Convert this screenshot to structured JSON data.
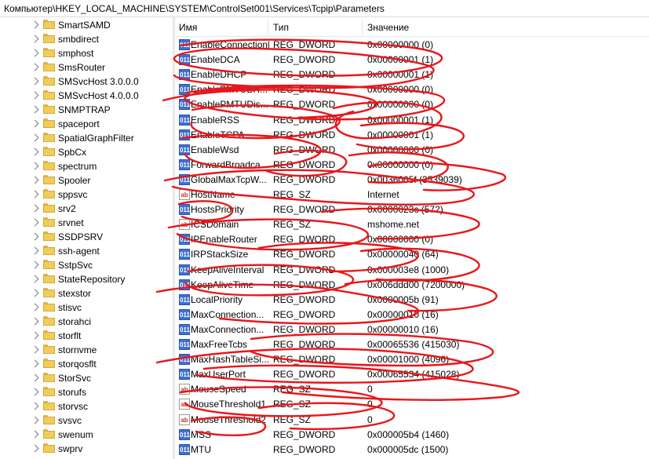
{
  "address": "Компьютер\\HKEY_LOCAL_MACHINE\\SYSTEM\\ControlSet001\\Services\\Tcpip\\Parameters",
  "tree": {
    "items": [
      "SmartSAMD",
      "smbdirect",
      "smphost",
      "SmsRouter",
      "SMSvcHost 3.0.0.0",
      "SMSvcHost 4.0.0.0",
      "SNMPTRAP",
      "spaceport",
      "SpatialGraphFilter",
      "SpbCx",
      "spectrum",
      "Spooler",
      "sppsvc",
      "srv2",
      "srvnet",
      "SSDPSRV",
      "ssh-agent",
      "SstpSvc",
      "StateRepository",
      "stexstor",
      "stisvc",
      "storahci",
      "storflt",
      "stornvme",
      "storqosflt",
      "StorSvc",
      "storufs",
      "storvsc",
      "svsvc",
      "swenum",
      "swprv"
    ]
  },
  "list": {
    "columns": {
      "name": "Имя",
      "type": "Тип",
      "data": "Значение"
    },
    "rows": [
      {
        "icon": "dword-value-icon",
        "name": "EnableConnectionRateLimiting",
        "type": "REG_DWORD",
        "data": "0x00000000 (0)"
      },
      {
        "icon": "dword-value-icon",
        "name": "EnableDCA",
        "type": "REG_DWORD",
        "data": "0x00000001 (1)"
      },
      {
        "icon": "dword-value-icon",
        "name": "EnableDHCP",
        "type": "REG_DWORD",
        "data": "0x00000001 (1)"
      },
      {
        "icon": "dword-value-icon",
        "name": "EnablePMTUBH...",
        "type": "REG_DWORD",
        "data": "0x00000000 (0)"
      },
      {
        "icon": "dword-value-icon",
        "name": "EnablePMTUDis...",
        "type": "REG_DWORD",
        "data": "0x00000000 (0)"
      },
      {
        "icon": "dword-value-icon",
        "name": "EnableRSS",
        "type": "REG_DWORD",
        "data": "0x00000001 (1)"
      },
      {
        "icon": "dword-value-icon",
        "name": "EnableTCPA",
        "type": "REG_DWORD",
        "data": "0x00000001 (1)"
      },
      {
        "icon": "dword-value-icon",
        "name": "EnableWsd",
        "type": "REG_DWORD",
        "data": "0x00000000 (0)"
      },
      {
        "icon": "dword-value-icon",
        "name": "ForwardBroadca...",
        "type": "REG_DWORD",
        "data": "0x00000000 (0)"
      },
      {
        "icon": "dword-value-icon",
        "name": "GlobalMaxTcpW...",
        "type": "REG_DWORD",
        "data": "0x0036005f (3539039)"
      },
      {
        "icon": "string-value-icon",
        "name": "HostName",
        "type": "REG_SZ",
        "data": "Internet"
      },
      {
        "icon": "dword-value-icon",
        "name": "HostsPriority",
        "type": "REG_DWORD",
        "data": "0x0000023c (572)"
      },
      {
        "icon": "string-value-icon",
        "name": "ICSDomain",
        "type": "REG_SZ",
        "data": "mshome.net"
      },
      {
        "icon": "dword-value-icon",
        "name": "IPEnableRouter",
        "type": "REG_DWORD",
        "data": "0x00000000 (0)"
      },
      {
        "icon": "dword-value-icon",
        "name": "IRPStackSize",
        "type": "REG_DWORD",
        "data": "0x00000040 (64)"
      },
      {
        "icon": "dword-value-icon",
        "name": "KeepAliveInterval",
        "type": "REG_DWORD",
        "data": "0x000003e8 (1000)"
      },
      {
        "icon": "dword-value-icon",
        "name": "KeepAliveTime",
        "type": "REG_DWORD",
        "data": "0x006ddd00 (7200000)"
      },
      {
        "icon": "dword-value-icon",
        "name": "LocalPriority",
        "type": "REG_DWORD",
        "data": "0x0000005b (91)"
      },
      {
        "icon": "dword-value-icon",
        "name": "MaxConnection...",
        "type": "REG_DWORD",
        "data": "0x00000010 (16)"
      },
      {
        "icon": "dword-value-icon",
        "name": "MaxConnection...",
        "type": "REG_DWORD",
        "data": "0x00000010 (16)"
      },
      {
        "icon": "dword-value-icon",
        "name": "MaxFreeTcbs",
        "type": "REG_DWORD",
        "data": "0x00065536 (415030)"
      },
      {
        "icon": "dword-value-icon",
        "name": "MaxHashTableSi...",
        "type": "REG_DWORD",
        "data": "0x00001000 (4096)"
      },
      {
        "icon": "dword-value-icon",
        "name": "MaxUserPort",
        "type": "REG_DWORD",
        "data": "0x00065534 (415028)"
      },
      {
        "icon": "string-value-icon",
        "name": "MouseSpeed",
        "type": "REG_SZ",
        "data": "0"
      },
      {
        "icon": "string-value-icon",
        "name": "MouseThreshold1",
        "type": "REG_SZ",
        "data": "0"
      },
      {
        "icon": "string-value-icon",
        "name": "MouseThreshold2",
        "type": "REG_SZ",
        "data": "0"
      },
      {
        "icon": "dword-value-icon",
        "name": "MSS",
        "type": "REG_DWORD",
        "data": "0x000005b4 (1460)"
      },
      {
        "icon": "dword-value-icon",
        "name": "MTU",
        "type": "REG_DWORD",
        "data": "0x000005dc (1500)"
      }
    ]
  },
  "colors": {
    "scribble": "#e8161b",
    "dword_icon": "#3f6fd1",
    "folder": "#f1cc5b"
  }
}
